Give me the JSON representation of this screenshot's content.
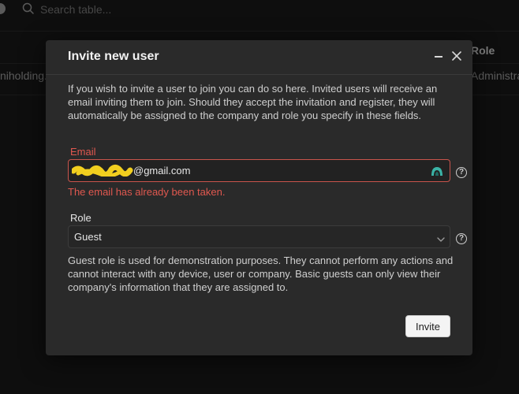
{
  "background": {
    "search_placeholder": "Search table...",
    "table": {
      "role_header": "Role",
      "row": {
        "company": "niholding.c",
        "role": "Administra"
      }
    }
  },
  "modal": {
    "title": "Invite new user",
    "description": "If you wish to invite a user to join you can do so here. Invited users will receive an email inviting them to join. Should they accept the invitation and register, they will automatically be assigned to the company and role you specify in these fields.",
    "email": {
      "label": "Email",
      "value": "@gmail.com",
      "error": "The email has already been taken."
    },
    "role": {
      "label": "Role",
      "selected": "Guest",
      "description": "Guest role is used for demonstration purposes. They cannot perform any actions and cannot interact with any device, user or company. Basic guests can only view their company's information that they are assigned to."
    },
    "invite_label": "Invite",
    "help_glyph": "?"
  },
  "colors": {
    "error": "#e0584f",
    "modal_bg": "#2a2a2a",
    "page_bg": "#161616",
    "redaction": "#f2cf1f",
    "badge": "#3bb3a6"
  },
  "icons": [
    "search-icon",
    "minimize-icon",
    "close-icon",
    "help-icon",
    "chevron-down-icon",
    "password-manager-icon"
  ]
}
